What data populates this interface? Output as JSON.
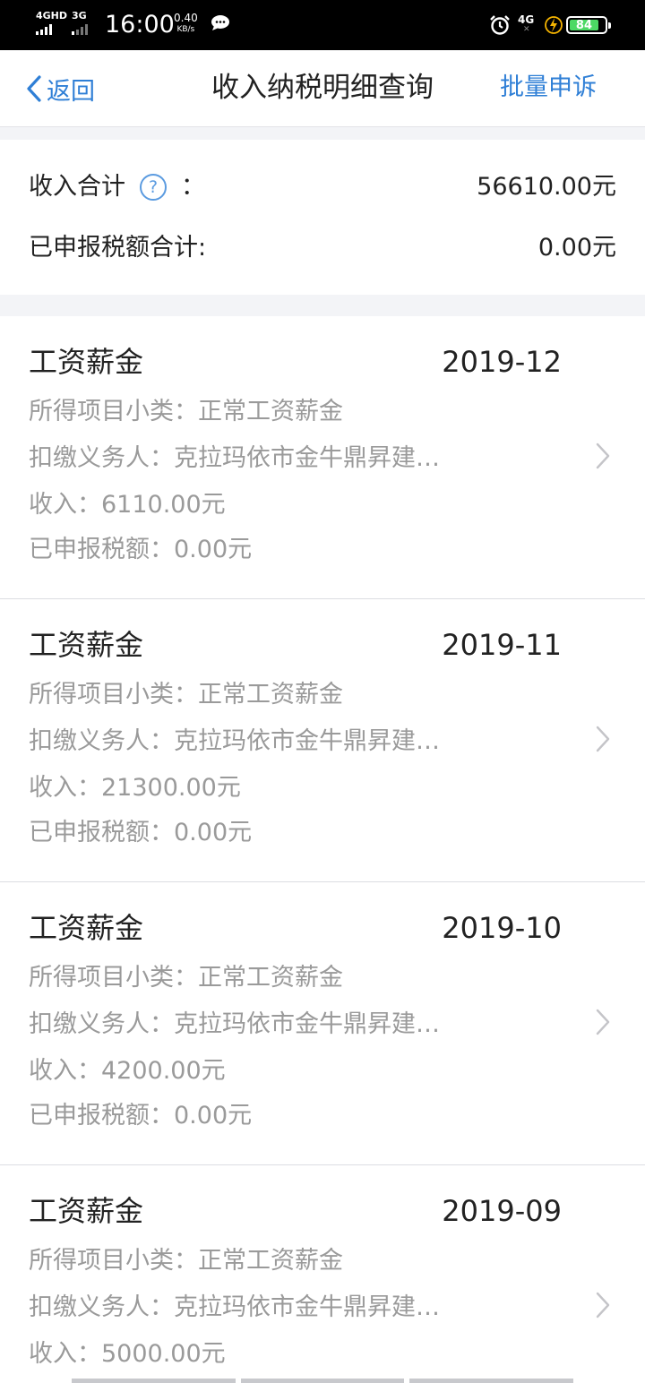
{
  "status_bar": {
    "net1": "4GHD",
    "net2": "3G",
    "time": "16:00",
    "speed_value": "0.40",
    "speed_unit": "KB/s",
    "net3": "4G",
    "battery_level": "84",
    "battery_color": "#4cd964"
  },
  "nav": {
    "back_label": "返回",
    "title": "收入纳税明细查询",
    "action_label": "批量申诉",
    "accent_color": "#2f7fd6"
  },
  "summary": {
    "income_label": "收入合计",
    "income_colon": "：",
    "income_value": "56610.00元",
    "tax_label": "已申报税额合计:",
    "tax_value": "0.00元"
  },
  "records": [
    {
      "type": "工资薪金",
      "period": "2019-12",
      "subcategory": "所得项目小类：正常工资薪金",
      "withholder": "扣缴义务人：克拉玛依市金牛鼎昇建…",
      "income": "收入：6110.00元",
      "tax": "已申报税额：0.00元"
    },
    {
      "type": "工资薪金",
      "period": "2019-11",
      "subcategory": "所得项目小类：正常工资薪金",
      "withholder": "扣缴义务人：克拉玛依市金牛鼎昇建…",
      "income": "收入：21300.00元",
      "tax": "已申报税额：0.00元"
    },
    {
      "type": "工资薪金",
      "period": "2019-10",
      "subcategory": "所得项目小类：正常工资薪金",
      "withholder": "扣缴义务人：克拉玛依市金牛鼎昇建…",
      "income": "收入：4200.00元",
      "tax": "已申报税额：0.00元"
    },
    {
      "type": "工资薪金",
      "period": "2019-09",
      "subcategory": "所得项目小类：正常工资薪金",
      "withholder": "扣缴义务人：克拉玛依市金牛鼎昇建…",
      "income": "收入：5000.00元",
      "tax": ""
    }
  ],
  "icons": {
    "back": "chevron-left-icon",
    "help": "question-circle-icon",
    "row_arrow": "chevron-right-icon",
    "help_glyph": "?"
  }
}
